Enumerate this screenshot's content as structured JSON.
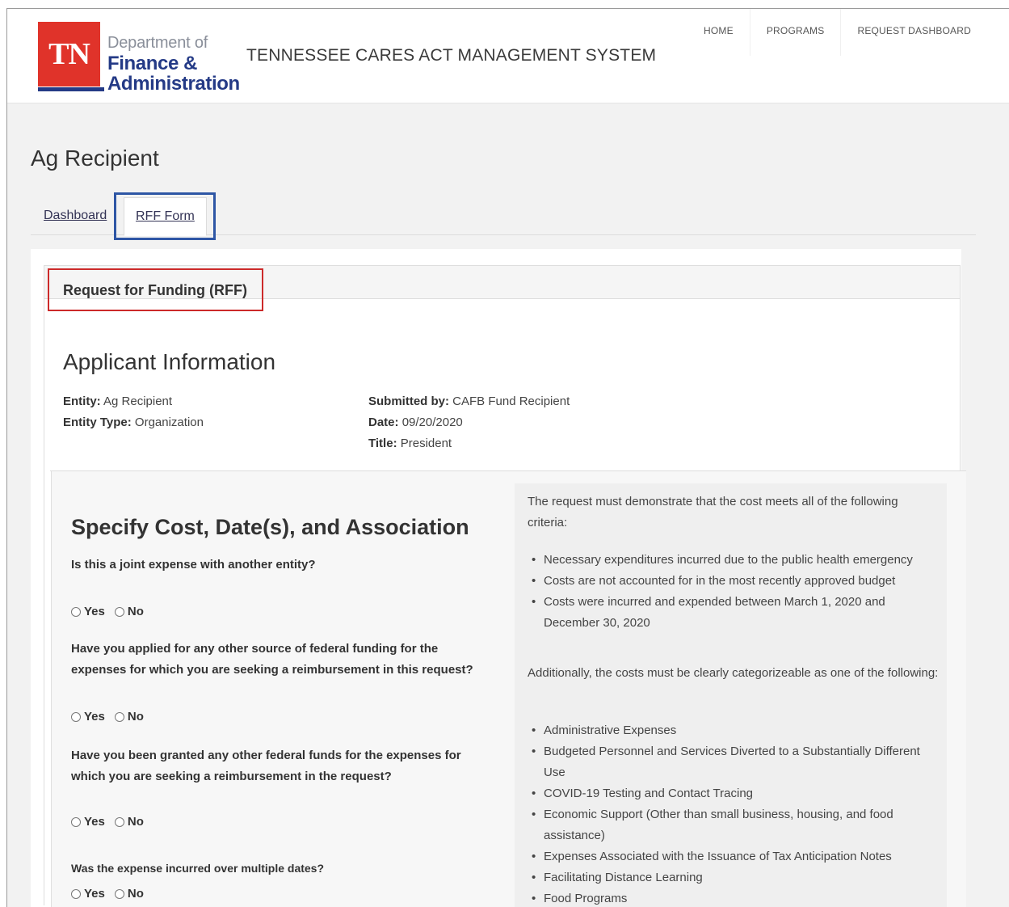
{
  "header": {
    "logo_mark": "TN",
    "logo_dept": "Department of",
    "logo_line1": "Finance &",
    "logo_line2": "Administration",
    "site_title": "TENNESSEE CARES ACT MANAGEMENT SYSTEM",
    "nav": [
      "HOME",
      "PROGRAMS",
      "REQUEST DASHBOARD"
    ]
  },
  "page_title": "Ag Recipient",
  "tabs": [
    "Dashboard",
    "RFF Form"
  ],
  "panel_title": "Request for Funding (RFF)",
  "applicant": {
    "heading": "Applicant Information",
    "entity_label": "Entity:",
    "entity_value": "Ag Recipient",
    "entity_type_label": "Entity Type:",
    "entity_type_value": "Organization",
    "submitted_by_label": "Submitted by:",
    "submitted_by_value": "CAFB Fund Recipient",
    "date_label": "Date:",
    "date_value": "09/20/2020",
    "title_label": "Title:",
    "title_value": "President"
  },
  "spec": {
    "heading": "Specify Cost, Date(s), and Association",
    "questions": [
      "Is this a joint expense with another entity?",
      "Have you applied for any other source of federal funding for the expenses for which you are seeking a reimbursement in this request?",
      "Have you been granted any other federal funds for the expenses for which you are seeking a reimbursement in the request?",
      "Was the expense incurred over multiple dates?"
    ],
    "yes_label": "Yes",
    "no_label": "No"
  },
  "criteria": {
    "intro": "The request must demonstrate that the cost meets all of the following criteria:",
    "items": [
      "Necessary expenditures incurred due to the public health emergency",
      "Costs are not accounted for in the most recently approved budget",
      "Costs were incurred and expended between March 1, 2020 and December 30, 2020"
    ],
    "additional": "Additionally, the costs must be clearly categorizeable as one of the following:",
    "categories": [
      "Administrative Expenses",
      "Budgeted Personnel and Services Diverted to a Substantially Different Use",
      "COVID-19 Testing and Contact Tracing",
      "Economic Support (Other than small business, housing, and food assistance)",
      "Expenses Associated with the Issuance of Tax Anticipation Notes",
      "Facilitating Distance Learning",
      "Food Programs"
    ]
  },
  "colors": {
    "logo_red": "#e0332a",
    "logo_blue": "#243a86",
    "highlight_blue": "#2e56a5",
    "highlight_red": "#cc2a2a"
  }
}
